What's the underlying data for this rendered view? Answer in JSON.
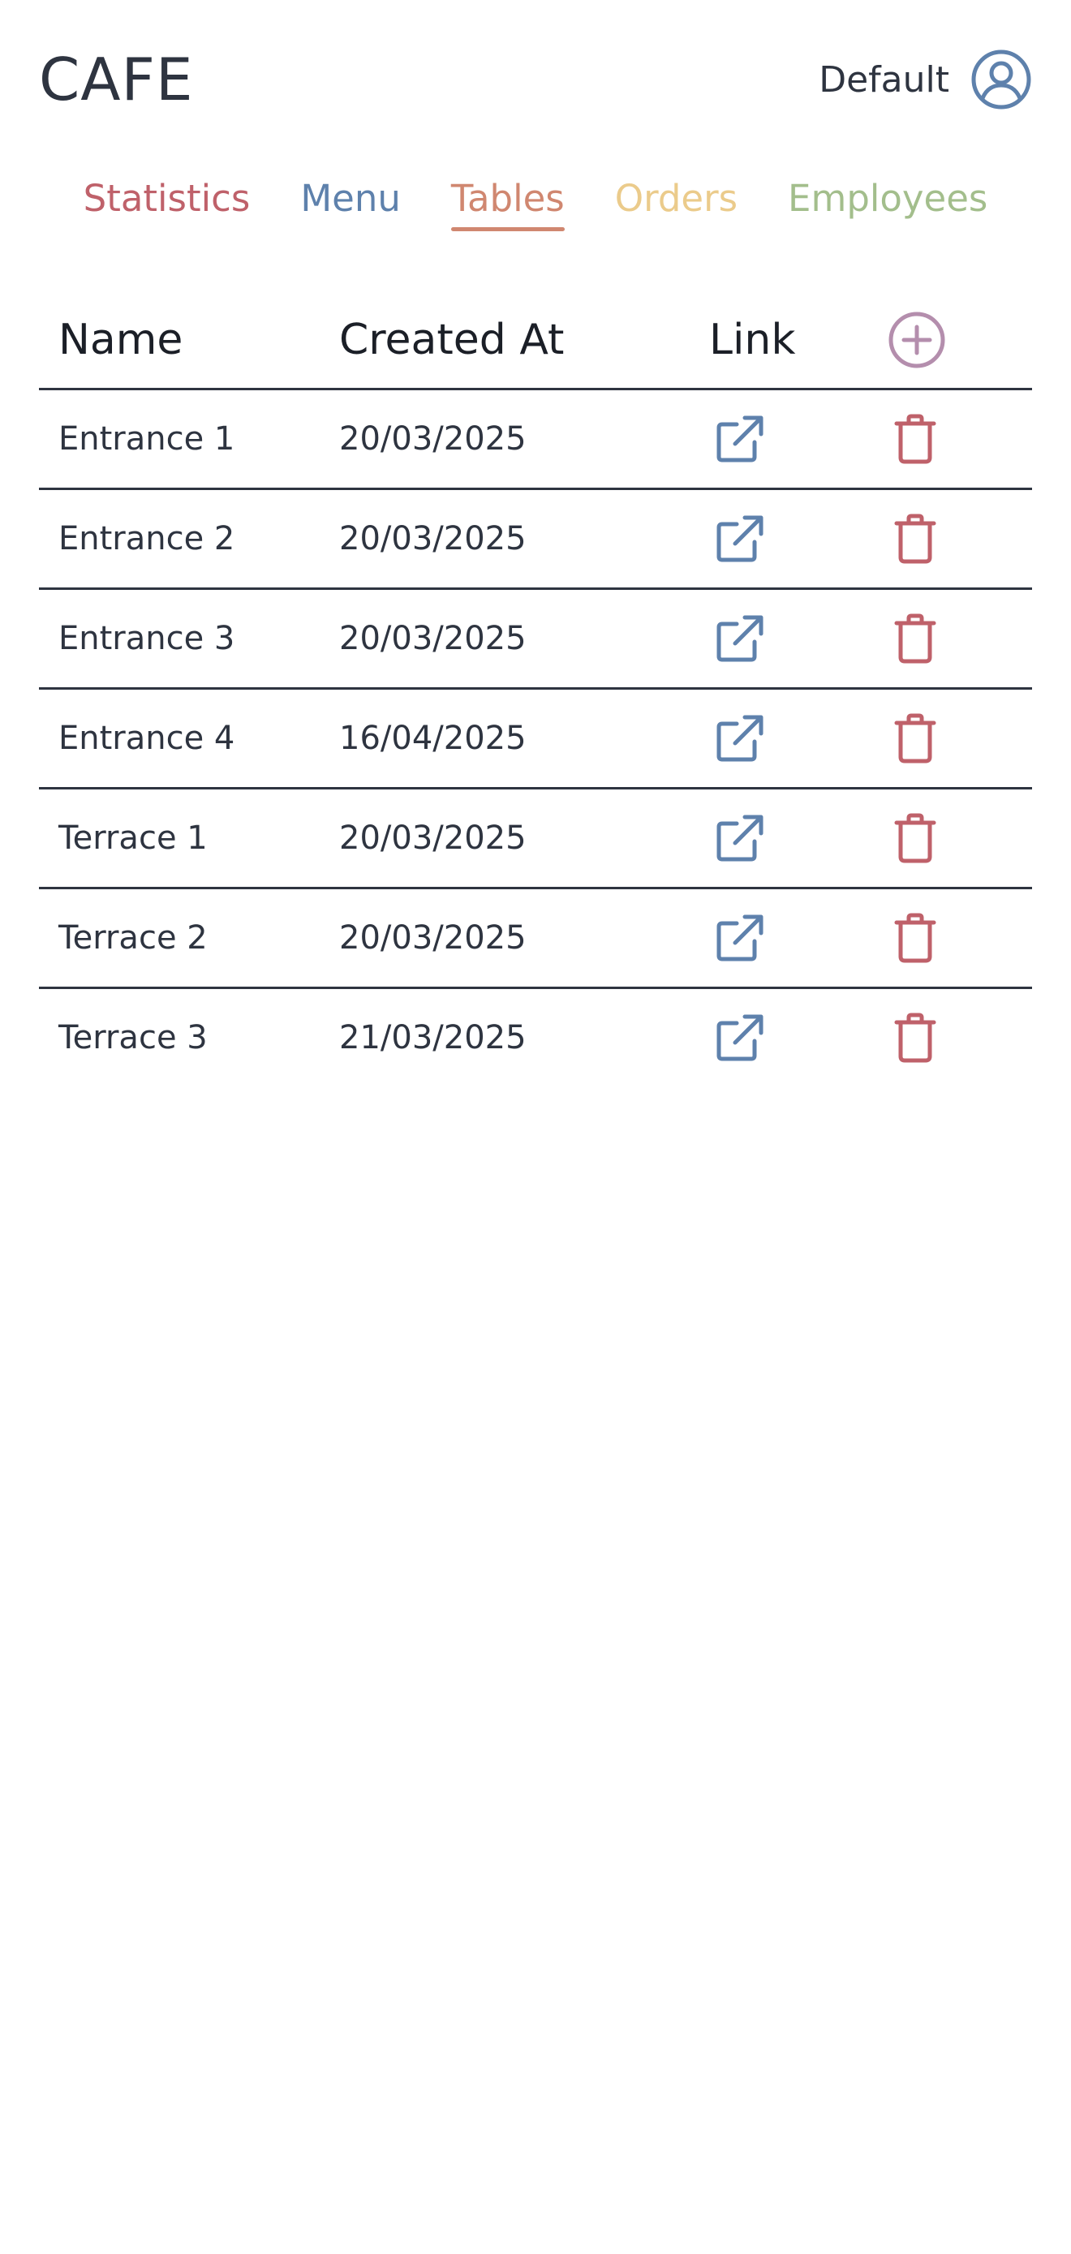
{
  "app": {
    "title": "CAFE"
  },
  "user": {
    "name": "Default",
    "icon": "user-circle-icon"
  },
  "nav": {
    "items": [
      {
        "label": "Statistics",
        "color": "#bf616a",
        "active": false
      },
      {
        "label": "Menu",
        "color": "#5e81ac",
        "active": false
      },
      {
        "label": "Tables",
        "color": "#d08770",
        "active": true
      },
      {
        "label": "Orders",
        "color": "#ebcb8b",
        "active": false
      },
      {
        "label": "Employees",
        "color": "#a3be8c",
        "active": false
      }
    ]
  },
  "table": {
    "headers": {
      "name": "Name",
      "created_at": "Created At",
      "link": "Link",
      "add_icon": "plus-circle-icon"
    },
    "rows": [
      {
        "name": "Entrance 1",
        "created_at": "20/03/2025"
      },
      {
        "name": "Entrance 2",
        "created_at": "20/03/2025"
      },
      {
        "name": "Entrance 3",
        "created_at": "20/03/2025"
      },
      {
        "name": "Entrance 4",
        "created_at": "16/04/2025"
      },
      {
        "name": "Terrace 1",
        "created_at": "20/03/2025"
      },
      {
        "name": "Terrace 2",
        "created_at": "20/03/2025"
      },
      {
        "name": "Terrace 3",
        "created_at": "21/03/2025"
      }
    ],
    "row_icons": {
      "link": "external-link-icon",
      "delete": "trash-icon"
    }
  },
  "colors": {
    "text": "#2e3440",
    "link_icon": "#5e81ac",
    "delete_icon": "#bf616a",
    "add_icon": "#b48ead",
    "active_underline": "#d08770"
  }
}
